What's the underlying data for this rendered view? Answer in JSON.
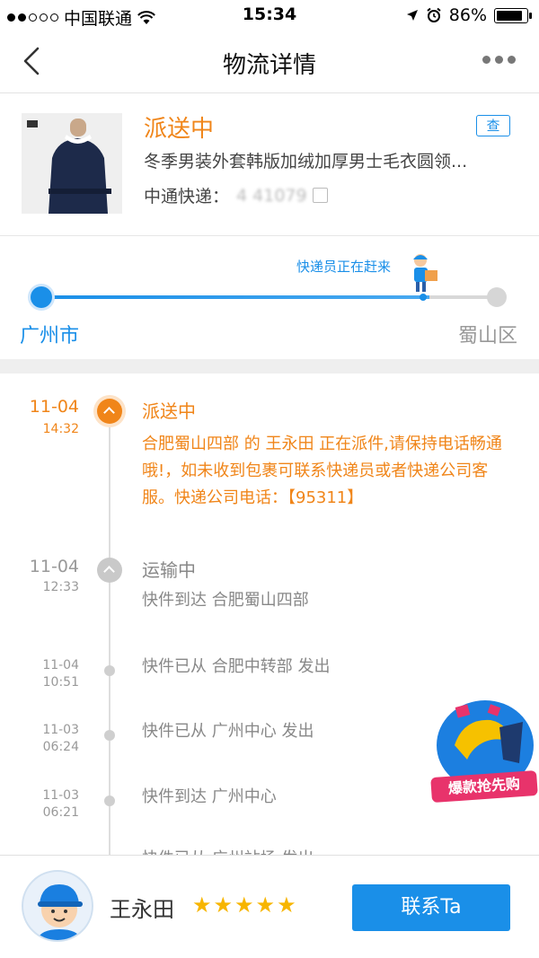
{
  "status_bar": {
    "carrier": "中国联通",
    "time": "15:34",
    "battery": "86%",
    "battery_level": 0.86,
    "signal_bars_filled": 2,
    "signal_bars_total": 5
  },
  "nav": {
    "title": "物流详情"
  },
  "product": {
    "status": "派送中",
    "query_label": "查",
    "name": "冬季男装外套韩版加绒加厚男士毛衣圆领...",
    "courier_company": "中通快递：",
    "tracking_number": "4          41079"
  },
  "progress": {
    "label": "快递员正在赶来",
    "from_city": "广州市",
    "to_city": "蜀山区",
    "fraction": 0.85
  },
  "timeline": [
    {
      "date": "11-04",
      "time": "14:32",
      "title": "派送中",
      "desc": "合肥蜀山四部 的 王永田 正在派件,请保持电话畅通哦!，如未收到包裹可联系快递员或者快递公司客服。快递公司电话：【95311】"
    },
    {
      "date": "11-04",
      "time": "12:33",
      "title": "运输中",
      "desc": "快件到达 合肥蜀山四部"
    },
    {
      "date": "11-04",
      "time": "10:51",
      "desc": "快件已从 合肥中转部 发出"
    },
    {
      "date": "11-03",
      "time": "06:24",
      "desc": "快件已从 广州中心 发出"
    },
    {
      "date": "11-03",
      "time": "06:21",
      "desc": "快件到达 广州中心"
    },
    {
      "desc": "快件已从 广州站场 发出"
    }
  ],
  "promo": {
    "label": "爆款抢先购"
  },
  "courier": {
    "name": "王永田",
    "rating": 5,
    "contact_label": "联系Ta"
  },
  "colors": {
    "accent_blue": "#1a8fe8",
    "active_orange": "#f08519",
    "star": "#f7b500"
  }
}
